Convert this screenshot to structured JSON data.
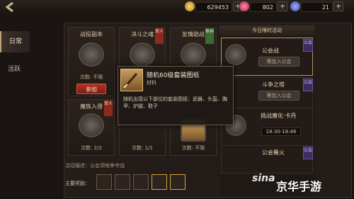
{
  "topbar": {
    "gold": "629453",
    "gems": "802",
    "tickets": "21"
  },
  "tabs": [
    {
      "label": "日常"
    },
    {
      "label": "活跃"
    }
  ],
  "cards": [
    {
      "title": "战役副本",
      "count": "次数: 不限",
      "button": "参加",
      "ribbon": ""
    },
    {
      "title": "决斗之魂",
      "count": "次数: 不限",
      "ribbon": "单人"
    },
    {
      "title": "友情助战",
      "count": "次数: 不限",
      "ribbon": "休闲"
    },
    {
      "title": "魔族入侵",
      "count": "次数: 2/2",
      "ribbon": "单人"
    },
    {
      "title": "",
      "count": "次数: 1/1",
      "ribbon": ""
    },
    {
      "title": "",
      "count": "次数: 不限",
      "ribbon": ""
    }
  ],
  "right": {
    "header": "今日限时活动",
    "rows": [
      {
        "title": "公会战",
        "button": "需加入公会",
        "badge": "公会"
      },
      {
        "title": "斗争之塔",
        "button": "需加入公会",
        "badge": "公会"
      },
      {
        "title": "挑战魔化·卡丹",
        "time": "18:30-18:46"
      },
      {
        "title": "公会篝火",
        "badge": "公会"
      }
    ]
  },
  "tooltip": {
    "name": "随机60级套装图纸",
    "type": "材料",
    "desc": "随机出现以下部位的套装图纸：武器、头盔、胸甲、护腿、鞋子"
  },
  "bottom": {
    "desc": "活动描述：公会领地争夺战",
    "reward_label": "主要奖励："
  },
  "watermark": {
    "brand": "sina",
    "text": "京华手游"
  }
}
